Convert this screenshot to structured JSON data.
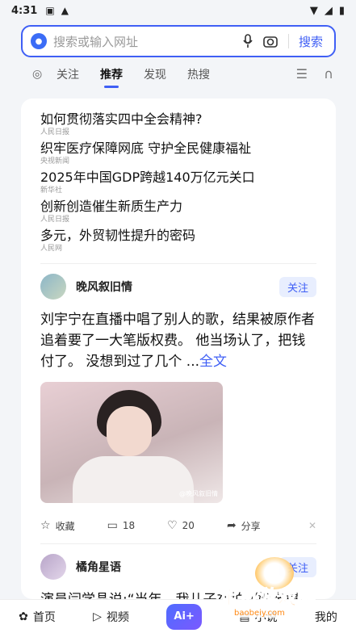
{
  "status": {
    "time": "4:31",
    "left_icons": [
      "notification-a-icon",
      "warning-icon"
    ],
    "right_icons": [
      "wifi-icon",
      "signal-icon",
      "battery-icon"
    ]
  },
  "search": {
    "placeholder": "搜索或输入网址",
    "button": "搜索"
  },
  "tabs": {
    "items": [
      "关注",
      "推荐",
      "发现",
      "热搜"
    ],
    "active": "推荐"
  },
  "news": [
    {
      "title": "如何贯彻落实四中全会精神?",
      "source": "人民日报"
    },
    {
      "title": "织牢医疗保障网底 守护全民健康福祉",
      "source": "央视新闻"
    },
    {
      "title": "2025年中国GDP跨越140万亿元关口",
      "source": "新华社"
    },
    {
      "title": "创新创造催生新质生产力",
      "source": "人民日报"
    },
    {
      "title": "多元，外贸韧性提升的密码",
      "source": "人民网"
    }
  ],
  "posts": [
    {
      "author": "晚风叙旧情",
      "follow": "关注",
      "text": "刘宇宁在直播中唱了别人的歌，结果被原作者追着要了一大笔版权费。 他当场认了，把钱付了。 没想到过了几个 ...",
      "more": "全文",
      "image_watermark": "@晚风叙旧情",
      "actions": {
        "save": "收藏",
        "comments": "18",
        "likes": "20",
        "share": "分享"
      }
    },
    {
      "author": "橘角星语",
      "follow": "关注",
      "text": "演员闫学晶说:“当年，我儿子在拍《娘亲舅大》时，有次我去探班，我跟导..."
    }
  ],
  "bottom_nav": {
    "items": [
      "首页",
      "视频",
      "Ai+",
      "小说",
      "我的"
    ]
  },
  "watermark": {
    "text": "宝贝游戏网",
    "url": "baobeiy.com"
  },
  "colors": {
    "accent": "#3f5ff5",
    "background": "#f3f5f8",
    "card": "#ffffff"
  }
}
